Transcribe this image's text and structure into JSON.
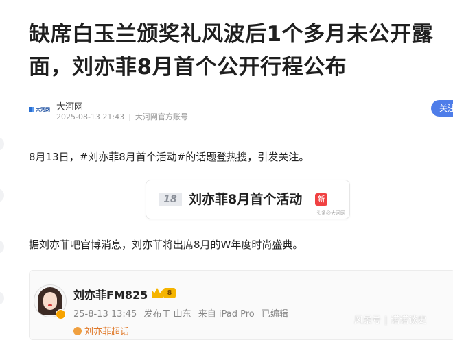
{
  "headline": "缺席白玉兰颁奖礼风波后1个多月未公开露面，刘亦菲8月首个公开行程公布",
  "source": {
    "logo_text": "大河网",
    "name": "大河网",
    "date": "2025-08-13 21:43",
    "account": "大河网官方账号",
    "follow_label": "关注"
  },
  "paragraphs": [
    "8月13日，#刘亦菲8月首个活动#的话题登热搜，引发关注。",
    "据刘亦菲吧官博消息，刘亦菲将出席8月的W年度时尚盛典。"
  ],
  "hot_topic": {
    "rank": "18",
    "title": "刘亦菲8月首个活动",
    "badge": "新",
    "source": "头条@大河网"
  },
  "weibo_post": {
    "username": "刘亦菲FM825",
    "level": "8",
    "time": "25-8-13 13:45",
    "location": "发布于 山东",
    "device": "来自 iPad Pro",
    "edited": "已编辑",
    "super_topic": "刘亦菲超话"
  },
  "watermark": {
    "brand": "风景号",
    "author": "诺诺谈史"
  },
  "colors": {
    "follow_button": "#4e7de9",
    "new_badge": "#f04142",
    "vip_gold": "#f5b400"
  }
}
